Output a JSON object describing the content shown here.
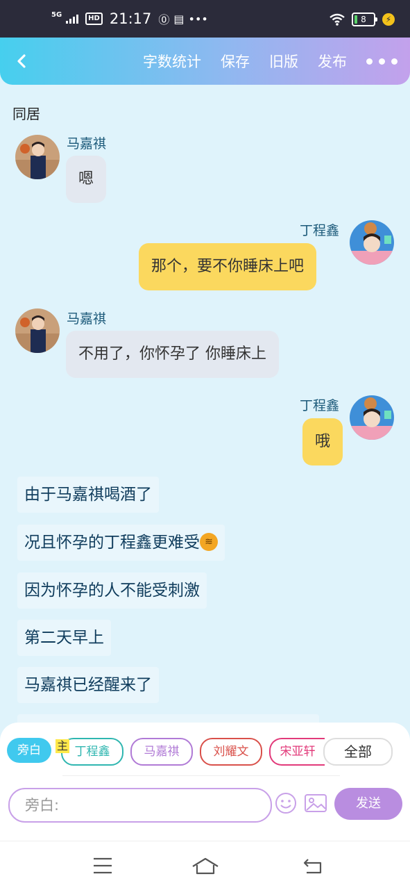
{
  "status_bar": {
    "network": "5G",
    "hd": "HD",
    "time": "21:17",
    "battery": "8"
  },
  "header": {
    "menu": [
      "字数统计",
      "保存",
      "旧版",
      "发布"
    ]
  },
  "doc_title": "同居",
  "messages": [
    {
      "speaker": "马嘉祺",
      "side": "left",
      "text": "嗯"
    },
    {
      "speaker": "丁程鑫",
      "side": "right",
      "text": "那个，要不你睡床上吧"
    },
    {
      "speaker": "马嘉祺",
      "side": "left",
      "text": "不用了，你怀孕了 你睡床上"
    },
    {
      "speaker": "丁程鑫",
      "side": "right",
      "text": "哦"
    }
  ],
  "narration": [
    "由于马嘉祺喝酒了",
    "况且怀孕的丁程鑫更难受",
    "因为怀孕的人不能受刺激",
    "第二天早上",
    "马嘉祺已经醒来了"
  ],
  "roles": {
    "selected": "旁白",
    "main_tag": "主",
    "chips": [
      "丁程鑫",
      "马嘉祺",
      "刘耀文",
      "宋亚轩"
    ],
    "all": "全部"
  },
  "composer": {
    "placeholder": "旁白:",
    "send": "发送"
  },
  "colors": {
    "header_start": "#46cfee",
    "header_end": "#c3a1ec",
    "bubble_right": "#fbd85e",
    "bubble_left": "#e3e8f0",
    "send_button": "#b98de0"
  }
}
